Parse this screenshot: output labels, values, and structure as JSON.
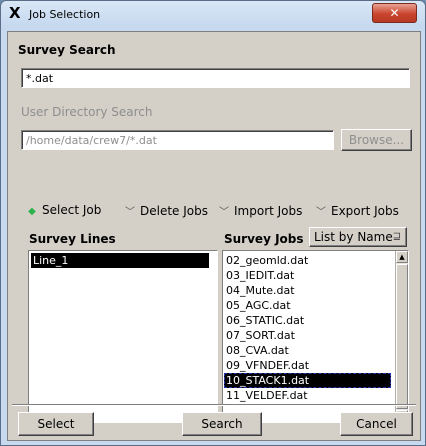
{
  "window": {
    "title": "Job Selection",
    "close_glyph": "✕",
    "app_icon": "X"
  },
  "survey_search": {
    "label": "Survey Search",
    "value": "*.dat"
  },
  "user_dir": {
    "label": "User Directory Search",
    "value": "/home/data/crew7/*.dat",
    "browse_label": "Browse..."
  },
  "modes": [
    {
      "label": "Select Job",
      "selected": true
    },
    {
      "label": "Delete Jobs",
      "selected": false
    },
    {
      "label": "Import Jobs",
      "selected": false
    },
    {
      "label": "Export Jobs",
      "selected": false
    }
  ],
  "survey_lines": {
    "label": "Survey Lines",
    "items": [
      "Line_1"
    ],
    "selected_index": 0
  },
  "survey_jobs": {
    "label": "Survey Jobs",
    "sort_option": "List by Name",
    "items": [
      "02_geomld.dat",
      "03_IEDIT.dat",
      "04_Mute.dat",
      "05_AGC.dat",
      "06_STATIC.dat",
      "07_SORT.dat",
      "08_CVA.dat",
      "09_VFNDEF.dat",
      "10_STACK1.dat",
      "11_VELDEF.dat"
    ],
    "selected_index": 8
  },
  "buttons": {
    "select": "Select",
    "search": "Search",
    "cancel": "Cancel"
  }
}
